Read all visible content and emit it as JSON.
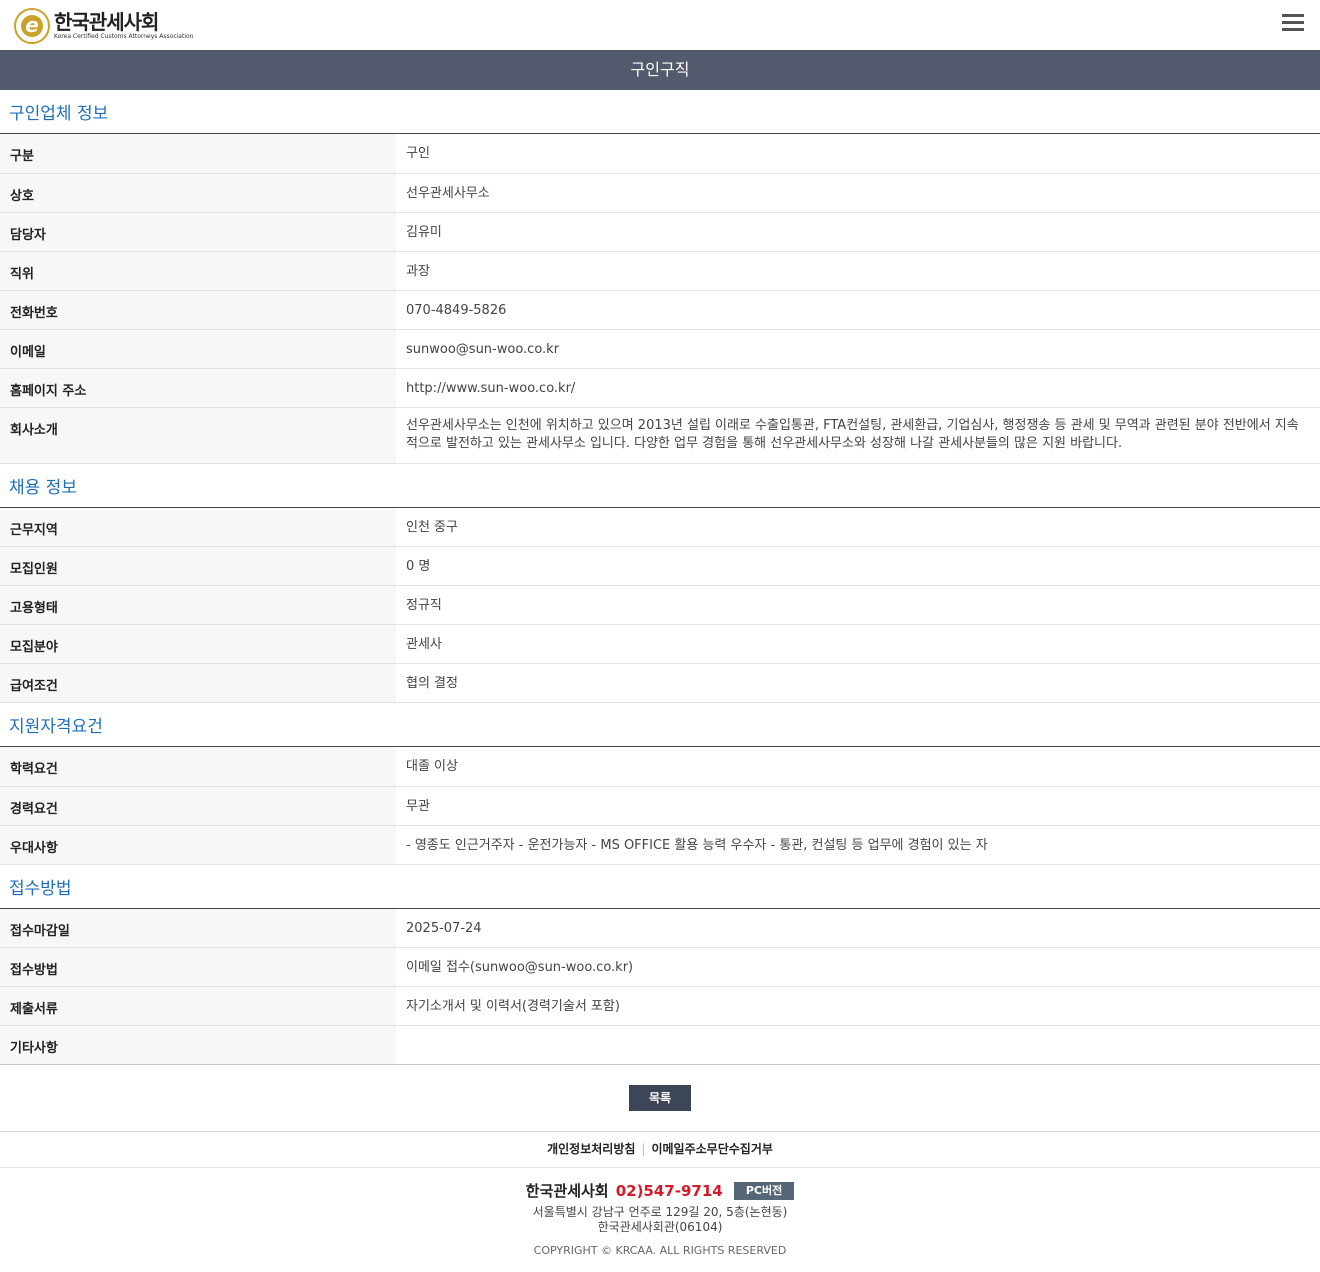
{
  "header": {
    "logo_name": "한국관세사회",
    "logo_sub": "Korea Certified Customs Attorneys Association",
    "menu_icon": "hamburger-menu-icon"
  },
  "page_title": "구인구직",
  "sections": {
    "company": {
      "title": "구인업체 정보",
      "rows": [
        {
          "label": "구분",
          "value": "구인"
        },
        {
          "label": "상호",
          "value": "선우관세사무소"
        },
        {
          "label": "담당자",
          "value": "김유미"
        },
        {
          "label": "직위",
          "value": "과장"
        },
        {
          "label": "전화번호",
          "value": "070-4849-5826"
        },
        {
          "label": "이메일",
          "value": "sunwoo@sun-woo.co.kr"
        },
        {
          "label": "홈페이지 주소",
          "value": "http://www.sun-woo.co.kr/"
        },
        {
          "label": "회사소개",
          "value": "선우관세사무소는 인천에 위치하고 있으며 2013년 설립 이래로 수출입통관, FTA컨설팅, 관세환급, 기업심사, 행정쟁송 등 관세 및 무역과 관련된 분야 전반에서 지속적으로 발전하고 있는 관세사무소 입니다. 다양한 업무 경험을 통해 선우관세사무소와 성장해 나갈 관세사분들의 많은 지원 바랍니다."
        }
      ]
    },
    "recruit": {
      "title": "채용 정보",
      "rows": [
        {
          "label": "근무지역",
          "value": "인천 중구"
        },
        {
          "label": "모집인원",
          "value": "0 명"
        },
        {
          "label": "고용형태",
          "value": "정규직"
        },
        {
          "label": "모집분야",
          "value": "관세사"
        },
        {
          "label": "급여조건",
          "value": "협의 결정"
        }
      ]
    },
    "qualification": {
      "title": "지원자격요건",
      "rows": [
        {
          "label": "학력요건",
          "value": "대졸 이상"
        },
        {
          "label": "경력요건",
          "value": "무관"
        },
        {
          "label": "우대사항",
          "value": "- 영종도 인근거주자 - 운전가능자 - MS OFFICE 활용 능력 우수자 - 통관, 컨설팅 등 업무에 경험이 있는 자"
        }
      ]
    },
    "apply": {
      "title": "접수방법",
      "rows": [
        {
          "label": "접수마감일",
          "value": "2025-07-24"
        },
        {
          "label": "접수방법",
          "value": "이메일 접수(sunwoo@sun-woo.co.kr)"
        },
        {
          "label": "제출서류",
          "value": "자기소개서 및 이력서(경력기술서 포함)"
        },
        {
          "label": "기타사항",
          "value": ""
        }
      ]
    }
  },
  "list_button": "목록",
  "footer": {
    "links": [
      "개인정보처리방침",
      "이메일주소무단수집거부"
    ],
    "separator": "|",
    "org": "한국관세사회",
    "phone": "02)547-9714",
    "pc_button": "PC버전",
    "address_line1": "서울특별시 강남구 언주로 129길 20, 5층(논현동)",
    "address_line2": "한국관세사회관(06104)",
    "copyright": "COPYRIGHT © KRCAA. ALL RIGHTS RESERVED"
  },
  "colors": {
    "title_bar": "#545a6d",
    "section_title": "#1f6fb8",
    "phone": "#d61a2c",
    "logo_gold": "#c9a227"
  }
}
